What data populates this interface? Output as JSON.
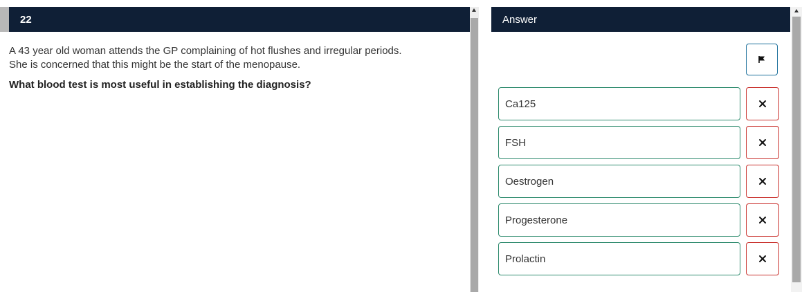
{
  "question": {
    "number": "22",
    "stem_lines": [
      "A 43 year old woman attends the GP complaining of hot flushes and irregular periods.",
      "She is concerned that this might be the start of the menopause."
    ],
    "lead_in": "What blood test is most useful in establishing the diagnosis?"
  },
  "answer_panel": {
    "title": "Answer",
    "flag_icon": "flag-icon",
    "strike_icon": "close-icon",
    "options": [
      {
        "label": "Ca125"
      },
      {
        "label": "FSH"
      },
      {
        "label": "Oestrogen"
      },
      {
        "label": "Progesterone"
      },
      {
        "label": "Prolactin"
      }
    ]
  },
  "colors": {
    "header_bg": "#0f1f36",
    "option_border": "#2e8b6e",
    "strike_border": "#c9302c",
    "flag_border": "#1a6e9a"
  }
}
